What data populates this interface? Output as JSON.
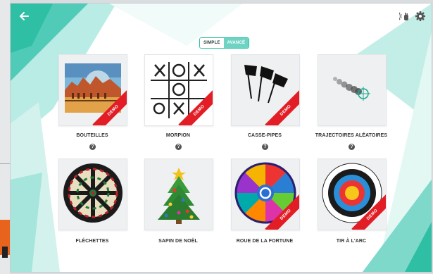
{
  "header": {
    "back_icon": "arrow-left-icon",
    "icons": [
      "wireless-hand-icon",
      "gear-icon"
    ]
  },
  "mode_toggle": {
    "simple": "SIMPLE",
    "advanced": "AVANCÉ"
  },
  "demo_label": "DEMO",
  "help_symbol": "?",
  "games": [
    {
      "label": "BOUTEILLES",
      "demo": true,
      "help": true
    },
    {
      "label": "MORPION",
      "demo": true,
      "help": true
    },
    {
      "label": "CASSE-PIPES",
      "demo": true,
      "help": true
    },
    {
      "label": "TRAJECTOIRES ALÉATOIRES",
      "demo": false,
      "help": true
    },
    {
      "label": "FLÉCHETTES",
      "demo": false,
      "help": false
    },
    {
      "label": "SAPIN DE NOËL",
      "demo": false,
      "help": false
    },
    {
      "label": "ROUE DE LA FORTUNE",
      "demo": true,
      "help": false
    },
    {
      "label": "TIR À L'ARC",
      "demo": true,
      "help": false
    }
  ],
  "colors": {
    "accent": "#2ebfa5",
    "demo": "#e31d25"
  }
}
